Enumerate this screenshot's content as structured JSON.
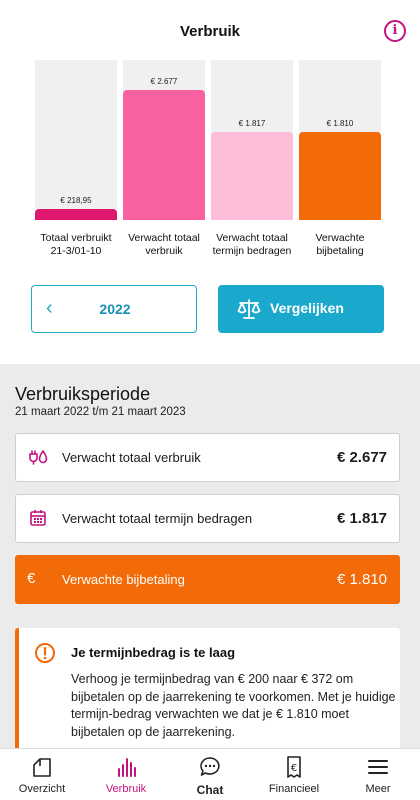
{
  "header": {
    "title": "Verbruik",
    "info_icon": "info-icon"
  },
  "chart_data": {
    "type": "bar",
    "categories": [
      "Totaal verbruikt 21-3/01-10",
      "Verwacht totaal verbruik",
      "Verwacht totaal termijn bedragen",
      "Verwachte bijbetaling"
    ],
    "values": [
      218.95,
      2677,
      1817,
      1810
    ],
    "value_labels": [
      "€ 218,95",
      "€ 2.677",
      "€ 1.817",
      "€ 1.810"
    ],
    "label_lines": [
      [
        "Totaal verbruikt",
        "21-3/01-10"
      ],
      [
        "Verwacht totaal",
        "verbruik"
      ],
      [
        "Verwacht totaal",
        "termijn bedragen"
      ],
      [
        "Verwachte",
        "bijbetaling"
      ]
    ],
    "colors": [
      "#e0176e",
      "#fa61a0",
      "#fbbdd7",
      "#f36a08"
    ],
    "ylim": [
      0,
      2677
    ],
    "grid": false
  },
  "controls": {
    "year": "2022",
    "compare_label": "Vergelijken",
    "accent": "#1ba8cd"
  },
  "period": {
    "title": "Verbruiksperiode",
    "range": "21 maart 2022 t/m 21 maart 2023"
  },
  "summary": [
    {
      "icon": "energy-drop-icon",
      "label": "Verwacht totaal verbruik",
      "value": "€ 2.677"
    },
    {
      "icon": "calendar-icon",
      "label": "Verwacht totaal termijn bedragen",
      "value": "€ 1.817"
    },
    {
      "icon": "euro-icon",
      "glyph": "€",
      "label": "Verwachte bijbetaling",
      "value": "€ 1.810"
    }
  ],
  "warning": {
    "title": "Je termijnbedrag is te laag",
    "text": "Verhoog je termijnbedrag van € 200 naar € 372 om bijbetalen op de jaarrekening te voorkomen. Met je huidige termijn-bedrag verwachten we dat je € 1.810 moet bijbetalen op de jaarrekening.",
    "color": "#f36a08"
  },
  "tabs": [
    {
      "label": "Overzicht",
      "icon": "house-icon"
    },
    {
      "label": "Verbruik",
      "icon": "bar-chart-icon",
      "active": true
    },
    {
      "label": "Chat",
      "icon": "chat-bubble-icon"
    },
    {
      "label": "Financieel",
      "icon": "invoice-icon"
    },
    {
      "label": "Meer",
      "icon": "menu-icon"
    }
  ]
}
